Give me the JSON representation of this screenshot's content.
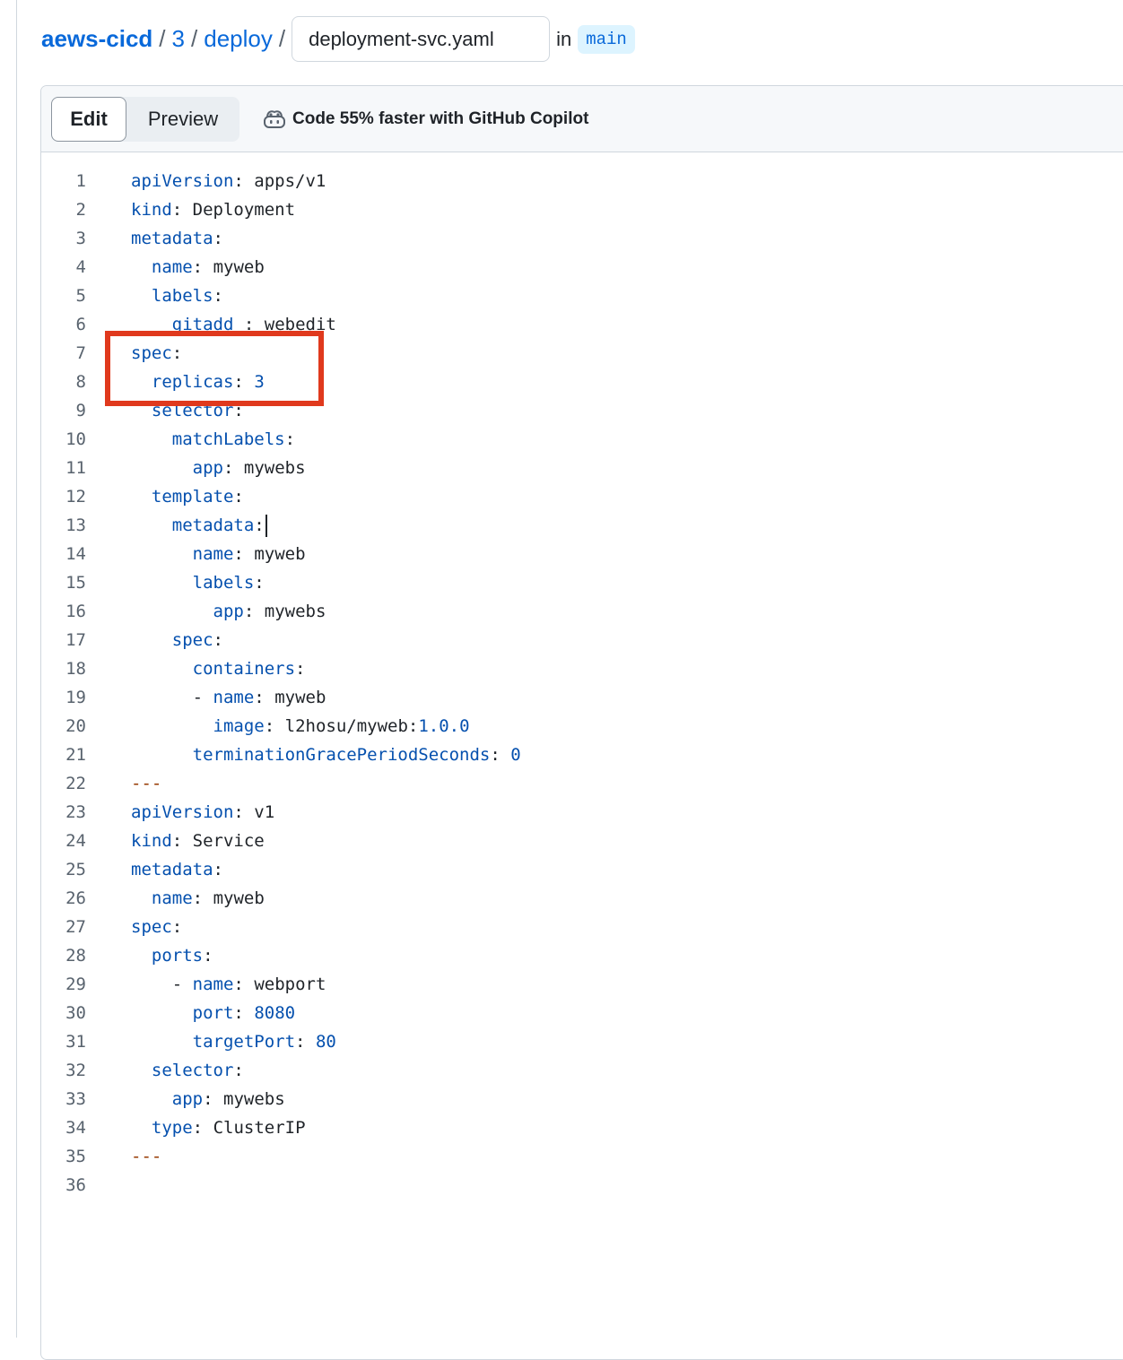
{
  "breadcrumb": {
    "repo": "aews-cicd",
    "sep": "/",
    "folder1": "3",
    "folder2": "deploy",
    "filename": "deployment-svc.yaml",
    "in_label": "in",
    "branch": "main"
  },
  "editor": {
    "tabs": {
      "edit": "Edit",
      "preview": "Preview"
    },
    "copilot_label": "Code 55% faster with GitHub Copilot",
    "copilot_icon": "copilot-icon",
    "cursor_line": 13,
    "highlight_lines": [
      7,
      8
    ],
    "lines": [
      "apiVersion: apps/v1",
      "kind: Deployment",
      "metadata:",
      "  name: myweb",
      "  labels:",
      "    gitadd : webedit",
      "spec:",
      "  replicas: 3",
      "  selector:",
      "    matchLabels:",
      "      app: mywebs",
      "  template:",
      "    metadata:",
      "      name: myweb",
      "      labels:",
      "        app: mywebs",
      "    spec:",
      "      containers:",
      "      - name: myweb",
      "        image: l2hosu/myweb:1.0.0",
      "      terminationGracePeriodSeconds: 0",
      "---",
      "apiVersion: v1",
      "kind: Service",
      "metadata:",
      "  name: myweb",
      "spec:",
      "  ports:",
      "    - name: webport",
      "      port: 8080",
      "      targetPort: 80",
      "  selector:",
      "    app: mywebs",
      "  type: ClusterIP",
      "---",
      ""
    ]
  },
  "colors": {
    "link": "#0969da",
    "yaml_key": "#0550ae",
    "yaml_doc_separator": "#953800",
    "highlight_border": "#e0391d"
  }
}
